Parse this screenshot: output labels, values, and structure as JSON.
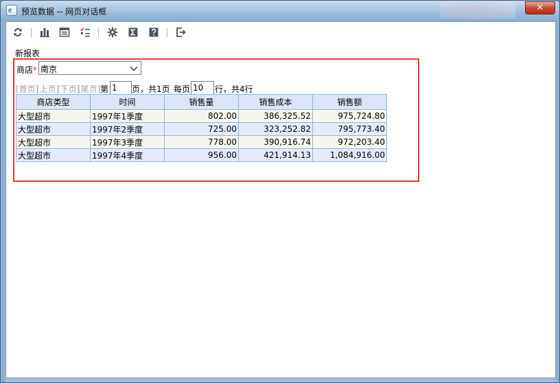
{
  "window": {
    "title": "预览数据 -- 网页对话框",
    "close": "✕"
  },
  "toolbar": {
    "icons": [
      "refresh-icon",
      "bar-chart-icon",
      "form-icon",
      "checklist-icon",
      "gear-icon",
      "sigma-icon",
      "help-icon",
      "exit-icon"
    ]
  },
  "report": {
    "title": "新报表",
    "param_label": "商店",
    "required_mark": "*",
    "store_value": "南京"
  },
  "pager": {
    "first": "[首页]",
    "prev": "[上页]",
    "next": "[下页]",
    "last": "[尾页]",
    "page_prefix": "第",
    "page_value": "1",
    "page_suffix": "页，共1页",
    "per_page_prefix": "每页",
    "per_page_value": "10",
    "per_page_suffix": "行，共4行"
  },
  "table": {
    "headers": [
      "商店类型",
      "时间",
      "销售量",
      "销售成本",
      "销售额"
    ],
    "rows": [
      [
        "大型超市",
        "1997年1季度",
        "802.00",
        "386,325.52",
        "975,724.80"
      ],
      [
        "大型超市",
        "1997年2季度",
        "725.00",
        "323,252.82",
        "795,773.40"
      ],
      [
        "大型超市",
        "1997年3季度",
        "778.00",
        "390,916.74",
        "972,203.40"
      ],
      [
        "大型超市",
        "1997年4季度",
        "956.00",
        "421,914.13",
        "1,084,916.00"
      ]
    ]
  },
  "colors": {
    "highlight_border": "#e53935",
    "header_bg": "#dbe5f5",
    "row_odd_bg": "#f6f6ee",
    "row_even_bg": "#e4eaf9",
    "grid_border": "#8eb5dc"
  }
}
